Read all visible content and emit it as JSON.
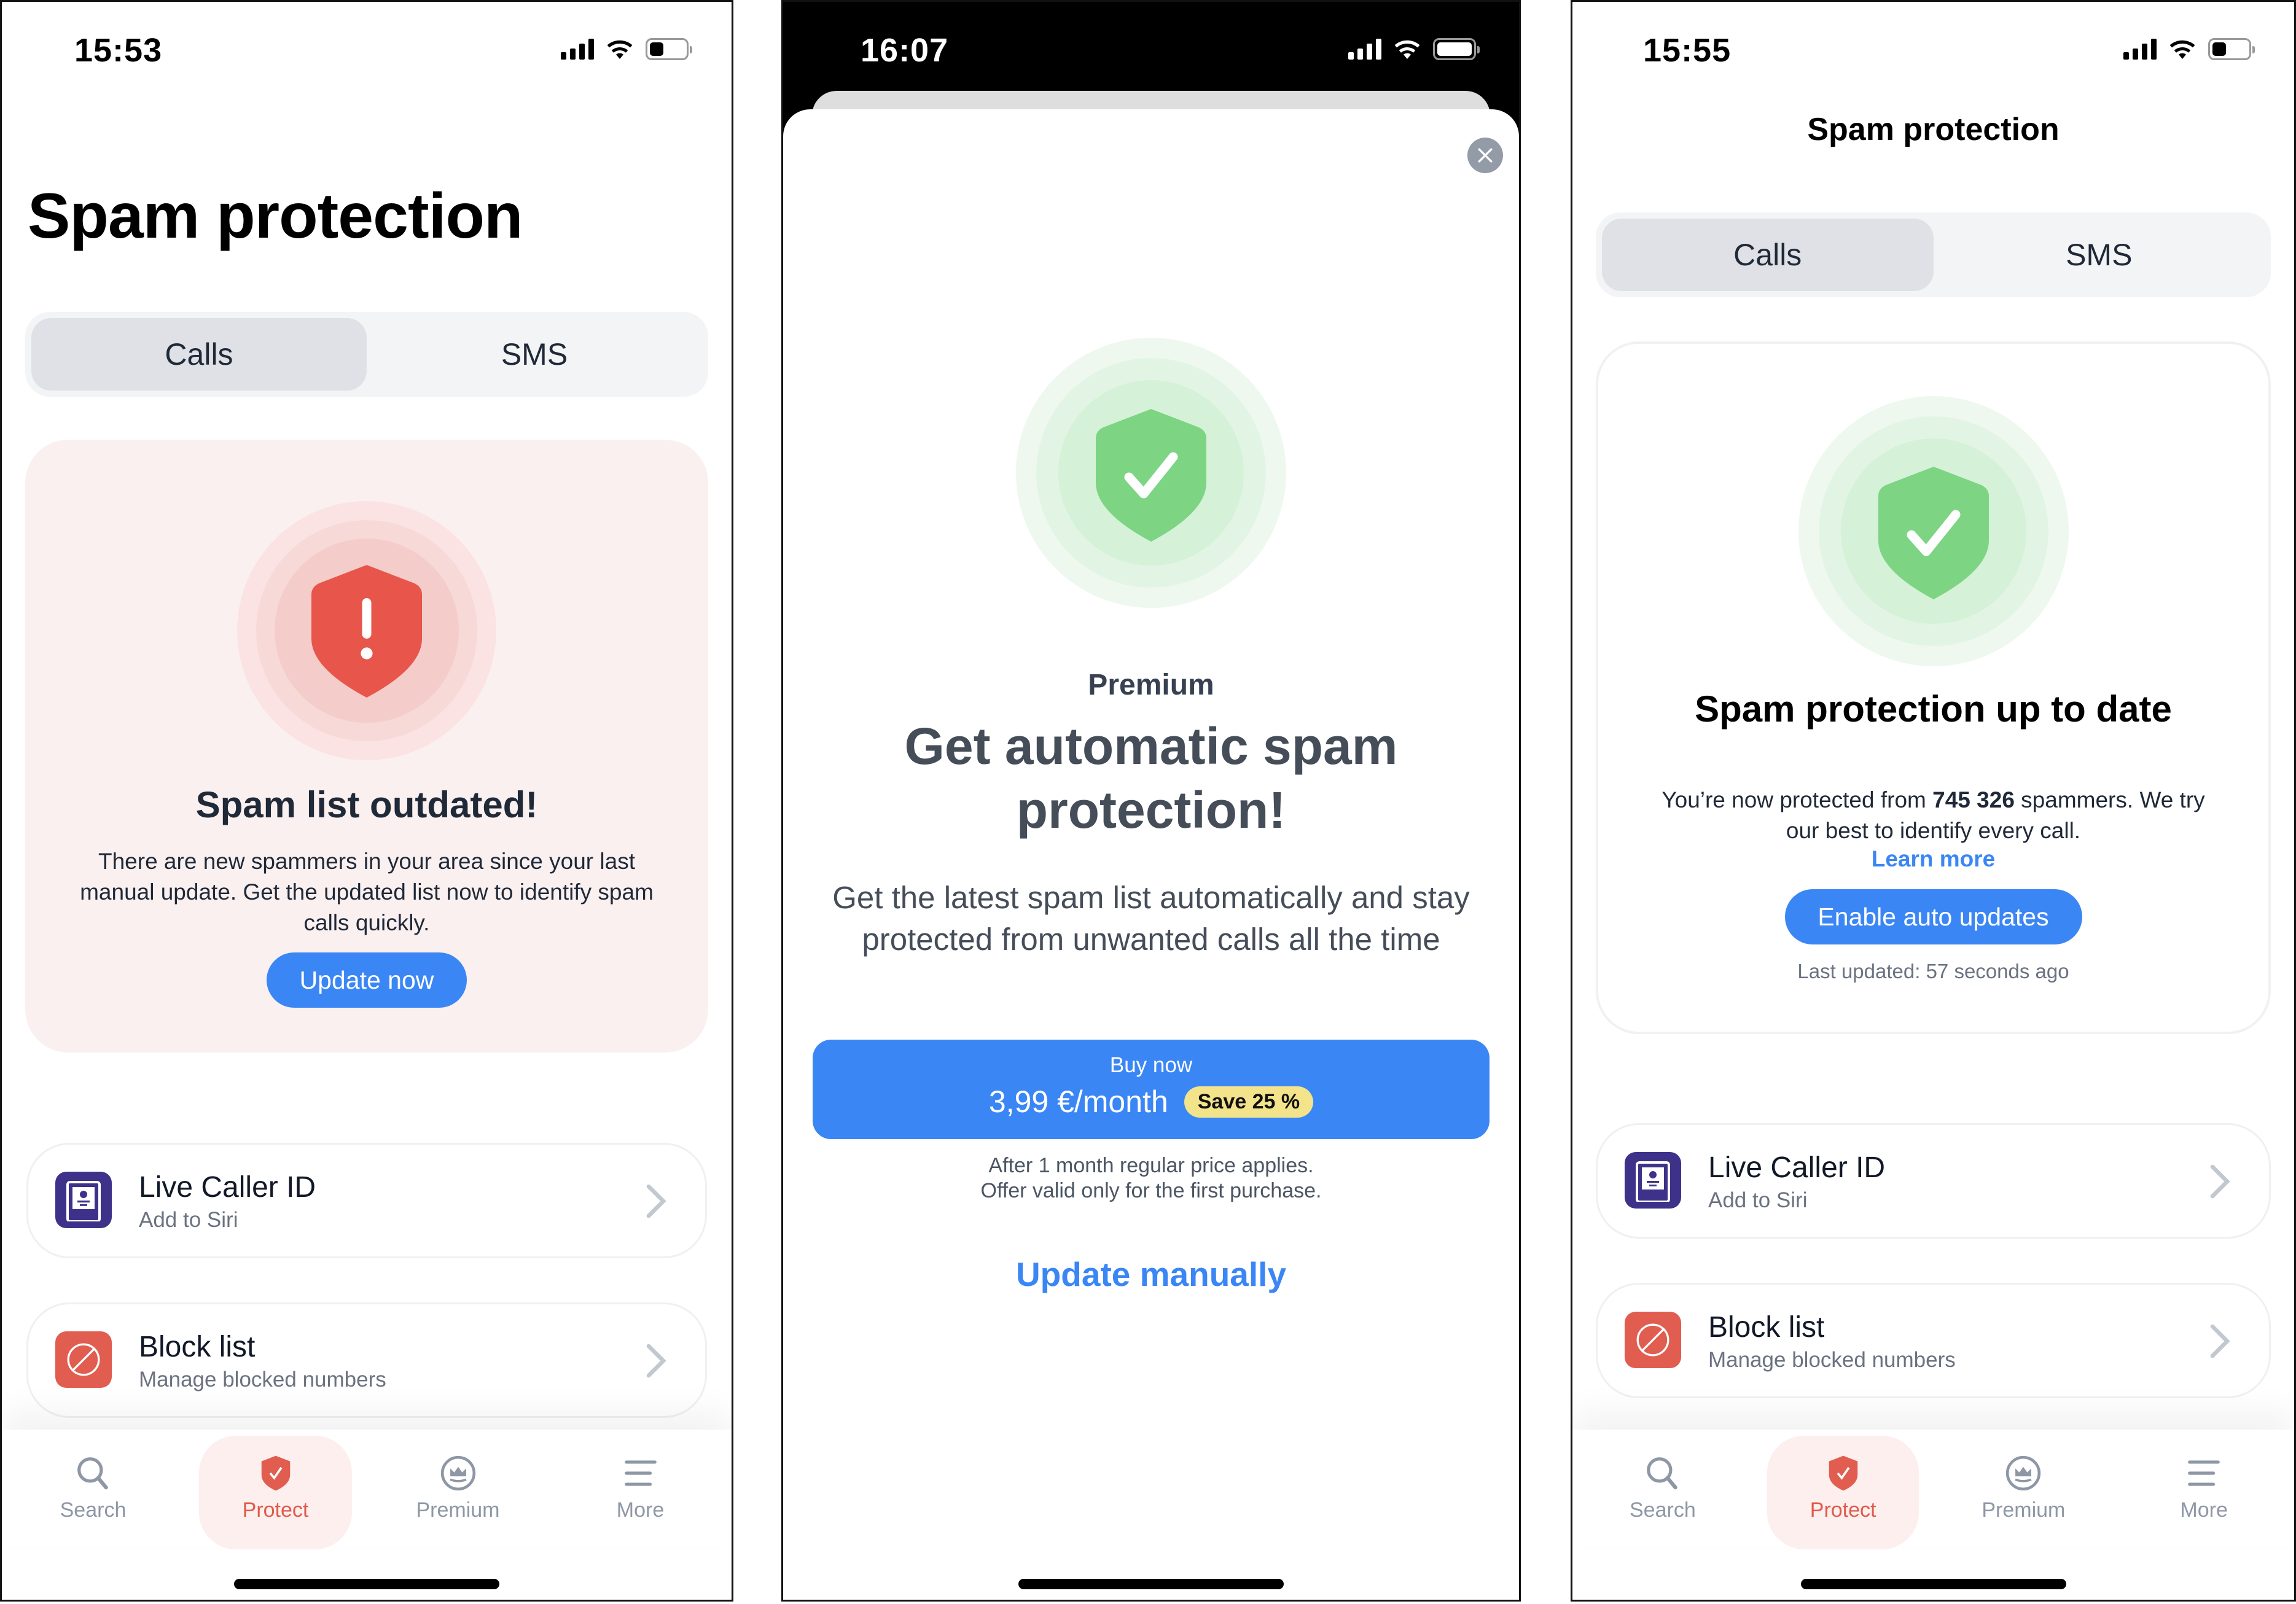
{
  "screens": [
    {
      "status": {
        "time": "15:53"
      },
      "title": "Spam protection",
      "segments": [
        {
          "label": "Calls",
          "active": true
        },
        {
          "label": "SMS",
          "active": false
        }
      ],
      "hero": {
        "state": "warning",
        "title": "Spam list outdated!",
        "text": "There are new spammers in your area since your last manual update. Get the updated list now to identify spam calls quickly.",
        "button": "Update now"
      },
      "list": [
        {
          "title": "Live Caller ID",
          "subtitle": "Add to Siri",
          "icon": "contact-card-icon"
        },
        {
          "title": "Block list",
          "subtitle": "Manage blocked numbers",
          "icon": "block-icon"
        }
      ],
      "tabs": [
        {
          "label": "Search",
          "icon": "search-icon",
          "active": false
        },
        {
          "label": "Protect",
          "icon": "shield-check-icon",
          "active": true
        },
        {
          "label": "Premium",
          "icon": "crown-icon",
          "active": false
        },
        {
          "label": "More",
          "icon": "menu-icon",
          "active": false
        }
      ]
    },
    {
      "status": {
        "time": "16:07"
      },
      "eyebrow": "Premium",
      "title": "Get automatic spam protection!",
      "text": "Get the latest spam list automatically and stay protected from unwanted calls all the time",
      "buy": {
        "label": "Buy now",
        "price": "3,99 €/month",
        "badge": "Save 25 %"
      },
      "fine_print": [
        "After 1 month regular price applies.",
        "Offer valid only for the first purchase."
      ],
      "secondary": "Update manually"
    },
    {
      "status": {
        "time": "15:55"
      },
      "title": "Spam protection",
      "segments": [
        {
          "label": "Calls",
          "active": true
        },
        {
          "label": "SMS",
          "active": false
        }
      ],
      "hero": {
        "state": "ok",
        "title": "Spam protection up to date",
        "text_before": "You’re now protected from ",
        "count": "745 326",
        "text_after": " spammers. We try our best to identify every call.",
        "link": "Learn more",
        "button": "Enable auto updates",
        "last_updated": "Last updated: 57 seconds ago"
      },
      "list": [
        {
          "title": "Live Caller ID",
          "subtitle": "Add to Siri",
          "icon": "contact-card-icon"
        },
        {
          "title": "Block list",
          "subtitle": "Manage blocked numbers",
          "icon": "block-icon"
        }
      ],
      "tabs": [
        {
          "label": "Search",
          "icon": "search-icon",
          "active": false
        },
        {
          "label": "Protect",
          "icon": "shield-check-icon",
          "active": true
        },
        {
          "label": "Premium",
          "icon": "crown-icon",
          "active": false
        },
        {
          "label": "More",
          "icon": "menu-icon",
          "active": false
        }
      ]
    }
  ],
  "colors": {
    "accent_blue": "#3b86f5",
    "danger_red": "#e8554a",
    "success_green": "#7dd483",
    "save_badge": "#f3e38b",
    "caller_id_purple": "#3e318a"
  }
}
